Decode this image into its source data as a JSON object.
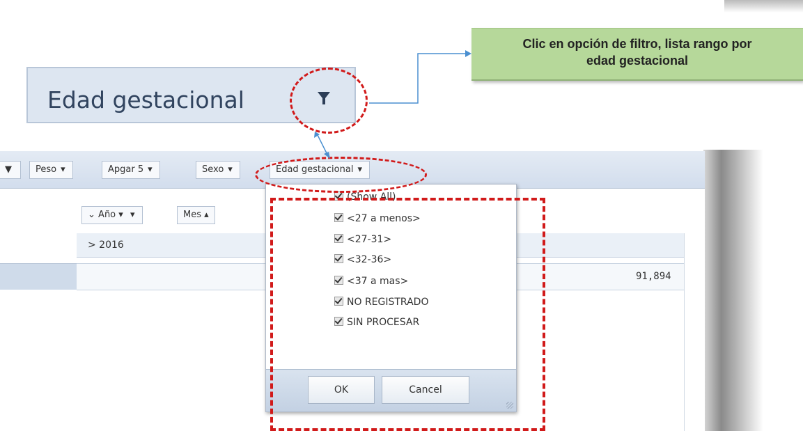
{
  "note": {
    "line1": "Clic en opción de filtro, lista rango por",
    "line2": "edad gestacional"
  },
  "zoom": {
    "label": "Edad gestacional",
    "icon": "filter-icon"
  },
  "toolbar": {
    "fields": [
      {
        "label": "Peso",
        "icon": "filter-icon"
      },
      {
        "label": "Apgar 5",
        "icon": "filter-icon"
      },
      {
        "label": "Sexo",
        "icon": "filter-icon"
      },
      {
        "label": "Edad gestacional",
        "icon": "filter-icon"
      }
    ]
  },
  "column_fields": [
    {
      "label": "Año",
      "prefix": "⌄",
      "suffix": "▾",
      "icon": "filter-icon"
    },
    {
      "label": "Mes",
      "suffix": "▴"
    }
  ],
  "grid": {
    "year_header": "> 2016",
    "grand_total": "91,894"
  },
  "filter_popup": {
    "items": [
      "(Show All)",
      "<27 a menos>",
      "<27-31>",
      "<32-36>",
      "<37 a mas>",
      "NO REGISTRADO",
      "SIN PROCESAR"
    ],
    "ok_label": "OK",
    "cancel_label": "Cancel"
  },
  "colors": {
    "annotation_red": "#d11a1a",
    "note_green": "#b6d89a",
    "connector_blue": "#4a8fd0"
  }
}
